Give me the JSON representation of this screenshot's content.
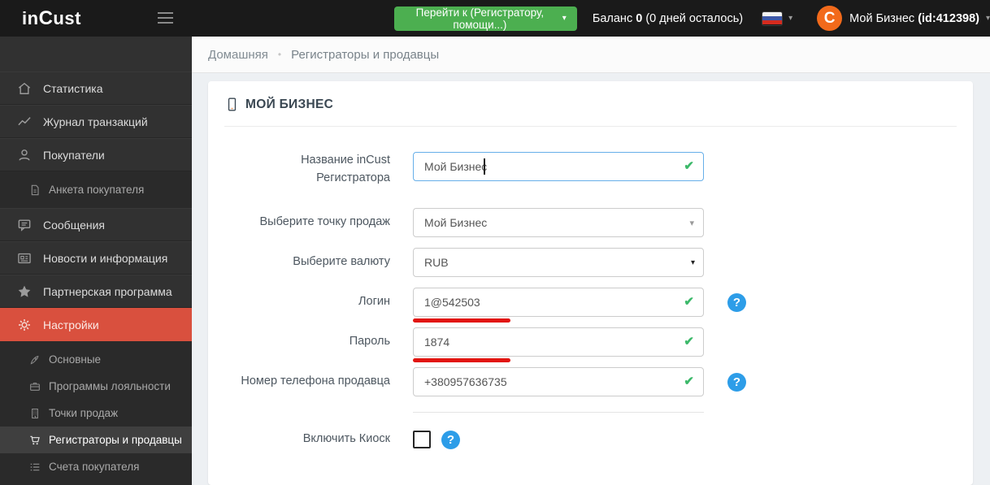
{
  "glyphs": {
    "caret_down": "▾",
    "check": "✔",
    "question": "?",
    "separator": "•"
  },
  "header": {
    "logo_in": "in",
    "logo_c": "C",
    "logo_ust": "ust",
    "goto_button_label": "Перейти к (Регистратору, помощи...)",
    "balance_label": "Баланс",
    "balance_value": "0",
    "balance_note": "(0 дней осталось)",
    "account_logo_letter": "C",
    "account_name": "Мой Бизнес",
    "account_id": "(id:412398)"
  },
  "sidebar": {
    "items": [
      {
        "label": "Статистика",
        "icon": "home-icon"
      },
      {
        "label": "Журнал транзакций",
        "icon": "chart-icon"
      },
      {
        "label": "Покупатели",
        "icon": "person-icon"
      },
      {
        "label": "Анкета покупателя",
        "icon": "document-icon"
      },
      {
        "label": "Сообщения",
        "icon": "chat-icon"
      },
      {
        "label": "Новости и информация",
        "icon": "news-icon"
      },
      {
        "label": "Партнерская программа",
        "icon": "star-icon"
      },
      {
        "label": "Настройки",
        "icon": "gear-icon",
        "active": true
      },
      {
        "label": "Основные",
        "icon": "rocket-icon"
      },
      {
        "label": "Программы лояльности",
        "icon": "briefcase-icon"
      },
      {
        "label": "Точки продаж",
        "icon": "building-icon"
      },
      {
        "label": "Регистраторы и продавцы",
        "icon": "cart-icon",
        "active": true
      },
      {
        "label": "Счета покупателя",
        "icon": "list-icon"
      }
    ]
  },
  "breadcrumb": {
    "home": "Домашняя",
    "current": "Регистраторы и продавцы"
  },
  "page": {
    "title": "МОЙ БИЗНЕС"
  },
  "form": {
    "fields": [
      {
        "label": "Название inCust Регистратора",
        "value": "Мой Бизнес",
        "type": "text",
        "valid": true,
        "focused": true
      },
      {
        "label": "Выберите точку продаж",
        "value": "Мой Бизнес",
        "type": "select"
      },
      {
        "label": "Выберите валюту",
        "value": "RUB",
        "type": "select"
      },
      {
        "label": "Логин",
        "value": "1@542503",
        "type": "text",
        "valid": true,
        "help": true,
        "underlined": true
      },
      {
        "label": "Пароль",
        "value": "1874",
        "type": "text",
        "valid": true,
        "underlined": true
      },
      {
        "label": "Номер телефона продавца",
        "value": "+380957636735",
        "type": "text",
        "valid": true,
        "help": true
      },
      {
        "label": "Включить Киоск",
        "type": "checkbox",
        "checked": false,
        "help": true
      }
    ]
  },
  "colors": {
    "sidebar_active_red": "#d9503e",
    "button_green": "#4caf50",
    "valid_green": "#3cb96a",
    "help_blue": "#2d9de8",
    "underline_red": "#e21510",
    "brand_orange": "#f26a1b",
    "focus_blue": "#66afe9",
    "header_black": "#1a1a1a"
  }
}
